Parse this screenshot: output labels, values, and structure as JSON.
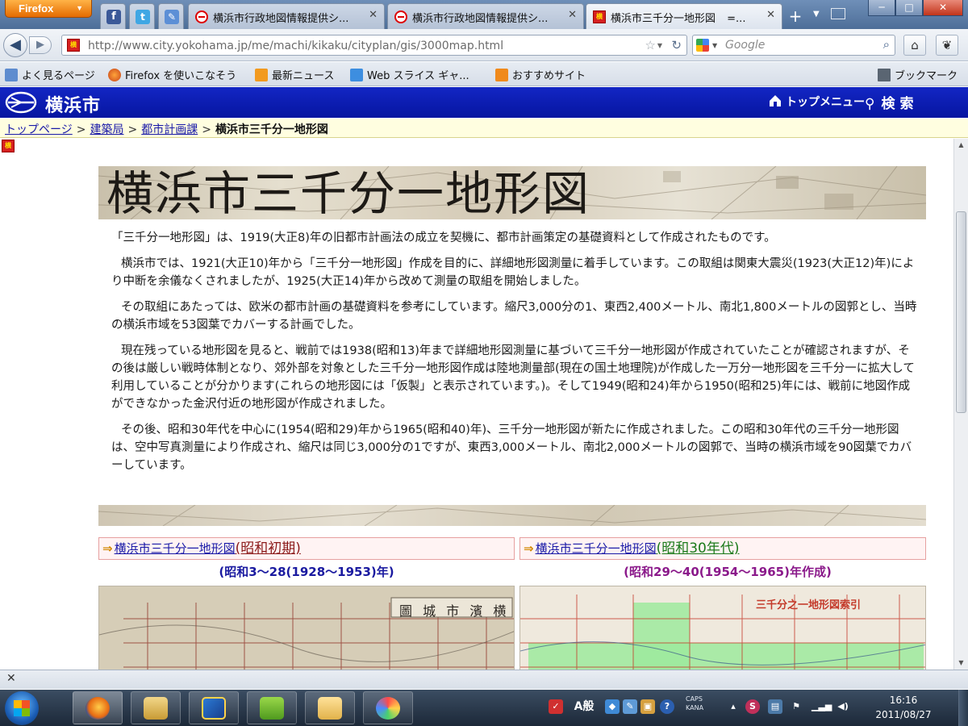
{
  "window": {
    "app_button": "Firefox",
    "controls": {
      "minimize": "─",
      "maximize": "□",
      "close": "✕"
    }
  },
  "tabs": [
    {
      "label": "横浜市行政地図情報提供シ...",
      "favicon": "yokohama-circle-icon",
      "active": false
    },
    {
      "label": "横浜市行政地図情報提供シ...",
      "favicon": "yokohama-circle-icon",
      "active": false
    },
    {
      "label": "横浜市三千分一地形図",
      "favicon": "yokohama-square-icon",
      "active": true,
      "tail": "=..."
    }
  ],
  "pinned_tabs": [
    "facebook-icon",
    "twitter-icon",
    "pencil-icon"
  ],
  "nav": {
    "url": "http://www.city.yokohama.jp/me/machi/kikaku/cityplan/gis/3000map.html",
    "search_placeholder": "Google"
  },
  "bookmarks": [
    {
      "label": "よく見るページ",
      "icon": "pages-icon"
    },
    {
      "label": "Firefox を使いこなそう",
      "icon": "firefox-icon"
    },
    {
      "label": "最新ニュース",
      "icon": "rss-icon"
    },
    {
      "label": "Web スライス ギャ...",
      "icon": "webslice-icon"
    },
    {
      "label": "おすすめサイト",
      "icon": "recommend-icon"
    }
  ],
  "bookmarks_menu": "ブックマーク",
  "site": {
    "name": "横浜市",
    "top_menu": "トップメニュー",
    "search": "検索"
  },
  "breadcrumb": {
    "items": [
      "トップページ",
      "建築局",
      "都市計画課"
    ],
    "current": "横浜市三千分一地形図"
  },
  "page": {
    "banner_title": "横浜市三千分一地形図",
    "paragraphs": [
      "「三千分一地形図」は、1919(大正8)年の旧都市計画法の成立を契機に、都市計画策定の基礎資料として作成されたものです。",
      "横浜市では、1921(大正10)年から「三千分一地形図」作成を目的に、詳細地形図測量に着手しています。この取組は関東大震災(1923(大正12)年)により中断を余儀なくされましたが、1925(大正14)年から改めて測量の取組を開始しました。",
      "その取組にあたっては、欧米の都市計画の基礎資料を参考にしています。縮尺3,000分の1、東西2,400メートル、南北1,800メートルの図郭とし、当時の横浜市域を53図葉でカバーする計画でした。",
      "現在残っている地形図を見ると、戦前では1938(昭和13)年まで詳細地形図測量に基づいて三千分一地形図が作成されていたことが確認されますが、その後は厳しい戦時体制となり、郊外部を対象とした三千分一地形図作成は陸地測量部(現在の国土地理院)が作成した一万分一地形図を三千分一に拡大して利用していることが分かります(これらの地形図には「仮製」と表示されています。)。そして1949(昭和24)年から1950(昭和25)年には、戦前に地図作成ができなかった金沢付近の地形図が作成されました。",
      "その後、昭和30年代を中心に(1954(昭和29)年から1965(昭和40)年)、三千分一地形図が新たに作成されました。この昭和30年代の三千分一地形図は、空中写真測量により作成され、縮尺は同じ3,000分の1ですが、東西3,000メートル、南北2,000メートルの図郭で、当時の横浜市域を90図葉でカバーしています。"
    ],
    "panels": [
      {
        "link": "横浜市三千分一地形図",
        "era": "(昭和初期)",
        "sub": "(昭和3〜28(1928〜1953)年)"
      },
      {
        "link": "横浜市三千分一地形図",
        "era": "(昭和30年代)",
        "sub": "(昭和29〜40(1954〜1965)年作成)"
      }
    ],
    "map1_caption": "圖 城 市 濱 横",
    "map2_caption": "三千分之一地形図索引"
  },
  "taskbar": {
    "apps": [
      "firefox-icon",
      "explorer-icon",
      "dictionary-icon",
      "evernote-icon",
      "folder-icon",
      "paint-icon"
    ],
    "ime": "A般",
    "caps": "CAPS",
    "kana": "KANA",
    "time": "16:16",
    "date": "2011/08/27"
  },
  "colors": {
    "site_header": "#0a1ab0",
    "breadcrumb_bg": "#fffee0",
    "link": "#1a1aa8",
    "era1": "#8b1a1a",
    "era2": "#1a7a1a"
  }
}
